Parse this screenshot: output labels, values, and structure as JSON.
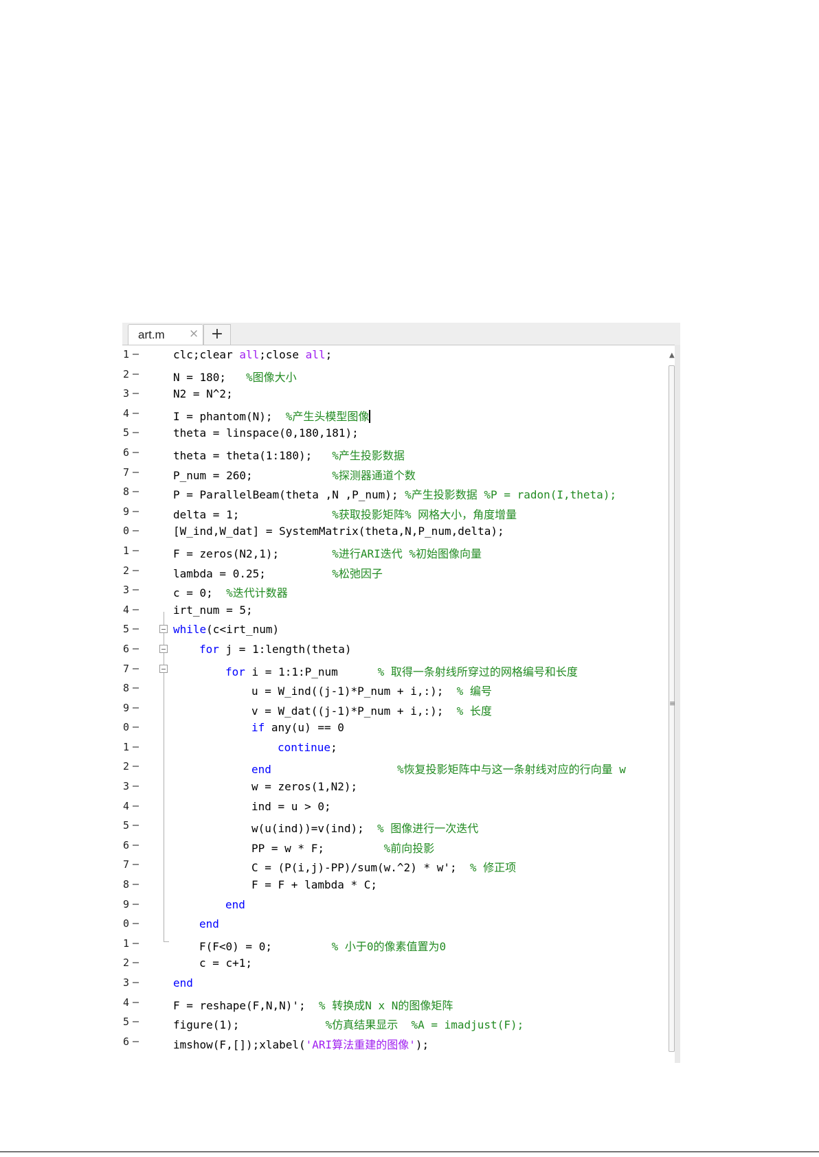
{
  "tab": {
    "label": "art.m",
    "close": "×",
    "add": "+"
  },
  "scroll": {
    "arrow": "▲",
    "grip": "≡"
  },
  "lines": [
    {
      "num": "1",
      "indent": 0,
      "parts": [
        {
          "t": "clc;clear "
        },
        {
          "t": "all",
          "c": "st"
        },
        {
          "t": ";close "
        },
        {
          "t": "all",
          "c": "st"
        },
        {
          "t": ";"
        }
      ]
    },
    {
      "num": "2",
      "indent": 0,
      "parts": [
        {
          "t": "N = 180;   "
        },
        {
          "t": "%图像大小",
          "c": "cm"
        }
      ]
    },
    {
      "num": "3",
      "indent": 0,
      "parts": [
        {
          "t": "N2 = N^2;"
        }
      ]
    },
    {
      "num": "4",
      "indent": 0,
      "caret": true,
      "parts": [
        {
          "t": "I = phantom(N);  "
        },
        {
          "t": "%产生头模型图像",
          "c": "cm"
        }
      ]
    },
    {
      "num": "5",
      "indent": 0,
      "parts": [
        {
          "t": "theta = linspace(0,180,181);"
        }
      ]
    },
    {
      "num": "6",
      "indent": 0,
      "parts": [
        {
          "t": "theta = theta(1:180);   "
        },
        {
          "t": "%产生投影数据",
          "c": "cm"
        }
      ]
    },
    {
      "num": "7",
      "indent": 0,
      "parts": [
        {
          "t": "P_num = 260;            "
        },
        {
          "t": "%探测器通道个数",
          "c": "cm"
        }
      ]
    },
    {
      "num": "8",
      "indent": 0,
      "parts": [
        {
          "t": "P = ParallelBeam(theta ,N ,P_num); "
        },
        {
          "t": "%产生投影数据 %P = radon(I,theta);",
          "c": "cm"
        }
      ]
    },
    {
      "num": "9",
      "indent": 0,
      "parts": [
        {
          "t": "delta = 1;              "
        },
        {
          "t": "%获取投影矩阵% 网格大小，角度增量",
          "c": "cm"
        }
      ]
    },
    {
      "num": "0",
      "indent": 0,
      "parts": [
        {
          "t": "[W_ind,W_dat] = SystemMatrix(theta,N,P_num,delta);"
        }
      ]
    },
    {
      "num": "1",
      "indent": 0,
      "parts": [
        {
          "t": "F = zeros(N2,1);        "
        },
        {
          "t": "%进行ARI迭代 %初始图像向量",
          "c": "cm"
        }
      ]
    },
    {
      "num": "2",
      "indent": 0,
      "parts": [
        {
          "t": "lambda = 0.25;          "
        },
        {
          "t": "%松弛因子",
          "c": "cm"
        }
      ]
    },
    {
      "num": "3",
      "indent": 0,
      "parts": [
        {
          "t": "c = 0;  "
        },
        {
          "t": "%迭代计数器",
          "c": "cm"
        }
      ]
    },
    {
      "num": "4",
      "indent": 0,
      "parts": [
        {
          "t": "irt_num = 5;"
        }
      ]
    },
    {
      "num": "5",
      "indent": 0,
      "fold": true,
      "parts": [
        {
          "t": "while",
          "c": "kw"
        },
        {
          "t": "(c<irt_num)"
        }
      ]
    },
    {
      "num": "6",
      "indent": 1,
      "fold": true,
      "parts": [
        {
          "t": "for",
          "c": "kw"
        },
        {
          "t": " j = 1:length(theta)"
        }
      ]
    },
    {
      "num": "7",
      "indent": 2,
      "fold": true,
      "parts": [
        {
          "t": "for",
          "c": "kw"
        },
        {
          "t": " i = 1:1:P_num      "
        },
        {
          "t": "% 取得一条射线所穿过的网格编号和长度",
          "c": "cm"
        }
      ]
    },
    {
      "num": "8",
      "indent": 3,
      "parts": [
        {
          "t": "u = W_ind((j-1)*P_num + i,:);  "
        },
        {
          "t": "% 编号",
          "c": "cm"
        }
      ]
    },
    {
      "num": "9",
      "indent": 3,
      "parts": [
        {
          "t": "v = W_dat((j-1)*P_num + i,:);  "
        },
        {
          "t": "% 长度",
          "c": "cm"
        }
      ]
    },
    {
      "num": "0",
      "indent": 3,
      "parts": [
        {
          "t": "if",
          "c": "kw"
        },
        {
          "t": " any(u) == 0"
        }
      ]
    },
    {
      "num": "1",
      "indent": 4,
      "parts": [
        {
          "t": "continue",
          "c": "kw"
        },
        {
          "t": ";"
        }
      ]
    },
    {
      "num": "2",
      "indent": 3,
      "parts": [
        {
          "t": "end",
          "c": "kw"
        },
        {
          "t": "                   "
        },
        {
          "t": "%恢复投影矩阵中与这一条射线对应的行向量 w",
          "c": "cm"
        }
      ]
    },
    {
      "num": "3",
      "indent": 3,
      "parts": [
        {
          "t": "w = zeros(1,N2);"
        }
      ]
    },
    {
      "num": "4",
      "indent": 3,
      "parts": [
        {
          "t": "ind = u > 0;"
        }
      ]
    },
    {
      "num": "5",
      "indent": 3,
      "parts": [
        {
          "t": "w(u(ind))=v(ind);  "
        },
        {
          "t": "% 图像进行一次迭代",
          "c": "cm"
        }
      ]
    },
    {
      "num": "6",
      "indent": 3,
      "parts": [
        {
          "t": "PP = w * F;         "
        },
        {
          "t": "%前向投影",
          "c": "cm"
        }
      ]
    },
    {
      "num": "7",
      "indent": 3,
      "parts": [
        {
          "t": "C = (P(i,j)-PP)/sum(w.^2) * w';  "
        },
        {
          "t": "% 修正项",
          "c": "cm"
        }
      ]
    },
    {
      "num": "8",
      "indent": 3,
      "parts": [
        {
          "t": "F = F + lambda * C;"
        }
      ]
    },
    {
      "num": "9",
      "indent": 2,
      "parts": [
        {
          "t": "end",
          "c": "kw"
        }
      ]
    },
    {
      "num": "0",
      "indent": 1,
      "parts": [
        {
          "t": "end",
          "c": "kw"
        }
      ]
    },
    {
      "num": "1",
      "indent": 1,
      "parts": [
        {
          "t": "F(F<0) = 0;         "
        },
        {
          "t": "% 小于0的像素值置为0",
          "c": "cm"
        }
      ]
    },
    {
      "num": "2",
      "indent": 1,
      "parts": [
        {
          "t": "c = c+1;"
        }
      ]
    },
    {
      "num": "3",
      "indent": 0,
      "parts": [
        {
          "t": "end",
          "c": "kw"
        }
      ]
    },
    {
      "num": "4",
      "indent": 0,
      "parts": [
        {
          "t": "F = reshape(F,N,N)';  "
        },
        {
          "t": "% 转换成N x N的图像矩阵",
          "c": "cm"
        }
      ]
    },
    {
      "num": "5",
      "indent": 0,
      "parts": [
        {
          "t": "figure(1);             "
        },
        {
          "t": "%仿真结果显示  %A = imadjust(F);",
          "c": "cm"
        }
      ]
    },
    {
      "num": "6",
      "indent": 0,
      "parts": [
        {
          "t": "imshow(F,[]);xlabel("
        },
        {
          "t": "'ARI算法重建的图像'",
          "c": "st"
        },
        {
          "t": ");"
        }
      ]
    }
  ]
}
